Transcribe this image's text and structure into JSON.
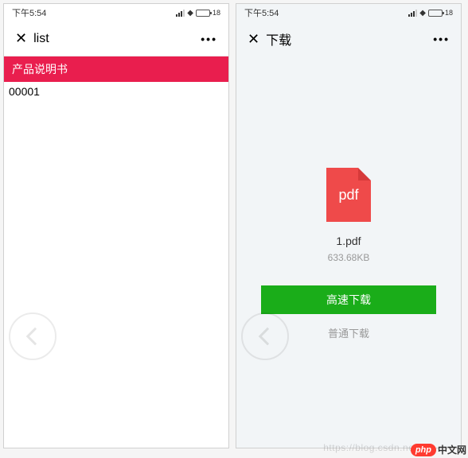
{
  "status": {
    "time": "下午5:54",
    "battery_pct": "18"
  },
  "left": {
    "nav_title": "list",
    "banner": "产品说明书",
    "item0": "00001"
  },
  "right": {
    "nav_title": "下载",
    "pdf_label": "pdf",
    "filename": "1.pdf",
    "filesize": "633.68KB",
    "fast_download": "高速下载",
    "normal_download": "普通下载"
  },
  "footer": {
    "watermark": "https://blog.csdn.net/",
    "logo_php": "php",
    "logo_cn": "中文网"
  }
}
